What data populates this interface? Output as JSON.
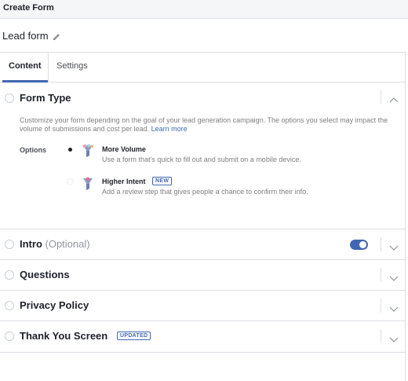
{
  "header": {
    "title": "Create Form"
  },
  "form": {
    "name": "Lead form"
  },
  "tabs": [
    {
      "label": "Content",
      "active": true
    },
    {
      "label": "Settings",
      "active": false
    }
  ],
  "form_type": {
    "title": "Form Type",
    "description": "Customize your form depending on the goal of your lead generation campaign. The options you select may impact the volume of submissions and cost per lead.",
    "learn_more": "Learn more",
    "options_label": "Options",
    "options": [
      {
        "name": "More Volume",
        "description": "Use a form that's quick to fill out and submit on a mobile device.",
        "selected": true,
        "icon": "funnel-icon"
      },
      {
        "name": "Higher Intent",
        "badge": "NEW",
        "description": "Add a review step that gives people a chance to confirm their info.",
        "selected": false,
        "icon": "funnel-icon"
      }
    ]
  },
  "sections": [
    {
      "title": "Intro",
      "subtitle": "(Optional)",
      "toggle_on": true
    },
    {
      "title": "Questions"
    },
    {
      "title": "Privacy Policy"
    },
    {
      "title": "Thank You Screen",
      "badge": "UPDATED"
    }
  ],
  "colors": {
    "accent": "#4267b2",
    "border": "#dddfe2",
    "text": "#1d2129",
    "muted": "#7f7f7f"
  }
}
